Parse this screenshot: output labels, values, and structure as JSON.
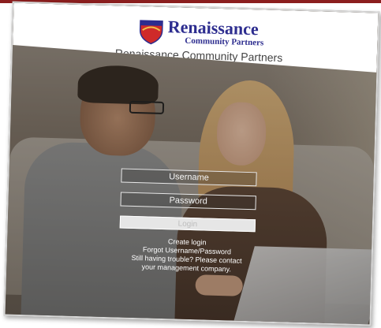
{
  "brand": {
    "name": "Renaissance",
    "sub": "Community Partners",
    "tagline": "Renaissance Community Partners"
  },
  "login": {
    "username_placeholder": "Username",
    "password_placeholder": "Password",
    "login_label": "Login"
  },
  "links": {
    "create_login": "Create login",
    "forgot": "Forgot Username/Password",
    "help_line1": "Still having trouble? Please contact",
    "help_line2": "your management company."
  },
  "colors": {
    "brand_blue": "#2d2d8f",
    "accent_red": "#8b1e1e"
  },
  "icons": {
    "logo": "shield-icon"
  }
}
